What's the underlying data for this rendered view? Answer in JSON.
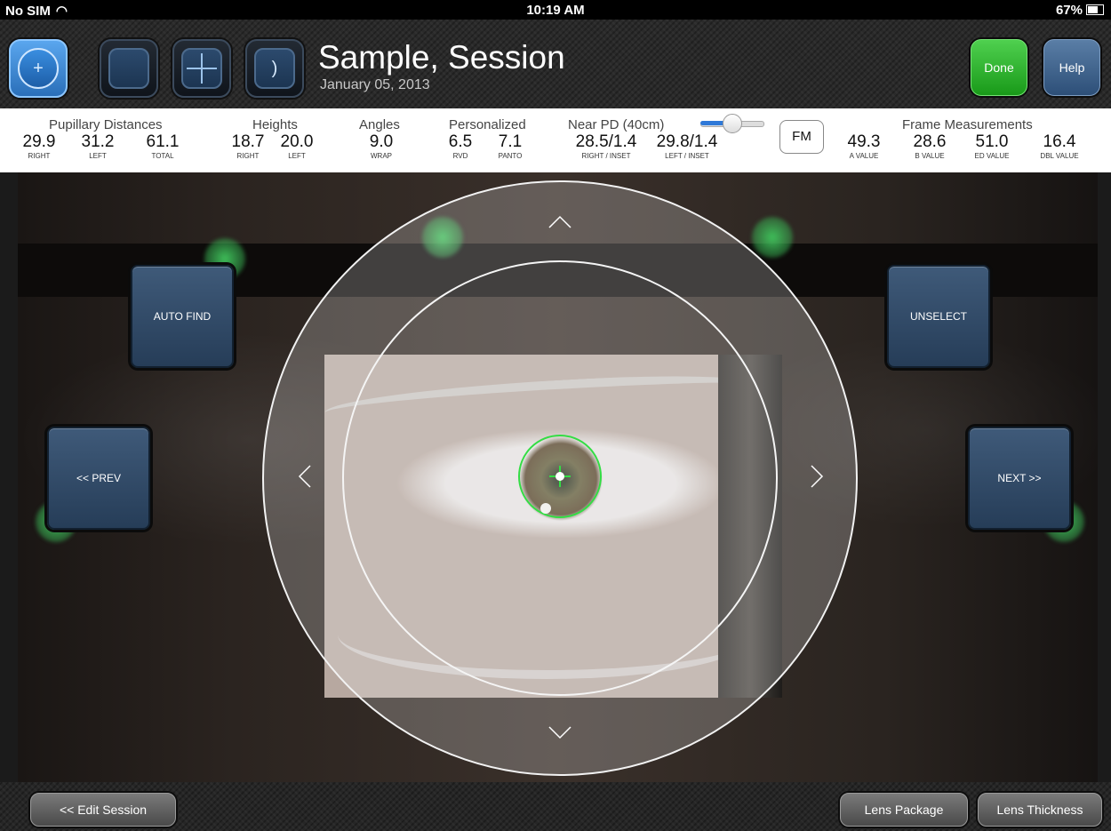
{
  "status_bar": {
    "carrier": "No SIM",
    "time": "10:19 AM",
    "battery": "67%"
  },
  "header": {
    "mode_tools": [
      {
        "name": "crosshair-tool",
        "glyph": "+"
      },
      {
        "name": "frame-tool",
        "glyph": ""
      },
      {
        "name": "grid-tool",
        "glyph": ""
      },
      {
        "name": "profile-tool",
        "glyph": ")"
      }
    ],
    "title": "Sample, Session",
    "date": "January 05, 2013",
    "done_label": "Done",
    "help_label": "Help"
  },
  "measurements": {
    "pupillary": {
      "label": "Pupillary Distances",
      "right": "29.9",
      "left": "31.2",
      "total": "61.1",
      "right_sub": "RIGHT",
      "left_sub": "LEFT",
      "total_sub": "TOTAL"
    },
    "heights": {
      "label": "Heights",
      "right": "18.7",
      "left": "20.0",
      "right_sub": "RIGHT",
      "left_sub": "LEFT"
    },
    "angles": {
      "label": "Angles",
      "wrap": "9.0",
      "wrap_sub": "WRAP"
    },
    "personalized": {
      "label": "Personalized",
      "rvd": "6.5",
      "panto": "7.1",
      "rvd_sub": "RVD",
      "panto_sub": "PANTO"
    },
    "near_pd": {
      "label": "Near PD (40cm)",
      "right": "28.5/1.4",
      "left": "29.8/1.4",
      "right_sub": "RIGHT / INSET",
      "left_sub": "LEFT / INSET",
      "slider_fraction": 0.5
    },
    "fm_label": "FM",
    "frame": {
      "label": "Frame Measurements",
      "a": "49.3",
      "b": "28.6",
      "ed": "51.0",
      "dbl": "16.4",
      "a_sub": "A VALUE",
      "b_sub": "B VALUE",
      "ed_sub": "ED VALUE",
      "dbl_sub": "DBL VALUE"
    }
  },
  "controls": {
    "auto_find": "AUTO FIND",
    "unselect": "UNSELECT",
    "prev": "<< PREV",
    "next": "NEXT >>",
    "arrow_up": "^",
    "arrow_down": "v",
    "arrow_left": "<",
    "arrow_right": ">"
  },
  "bottom": {
    "edit_session": "<< Edit Session",
    "lens_package": "Lens Package",
    "lens_thickness": "Lens Thickness"
  },
  "colors": {
    "accent_blue": "#2f79d8",
    "done_green": "#2fb52f",
    "pupil_marker": "#33dd44"
  }
}
